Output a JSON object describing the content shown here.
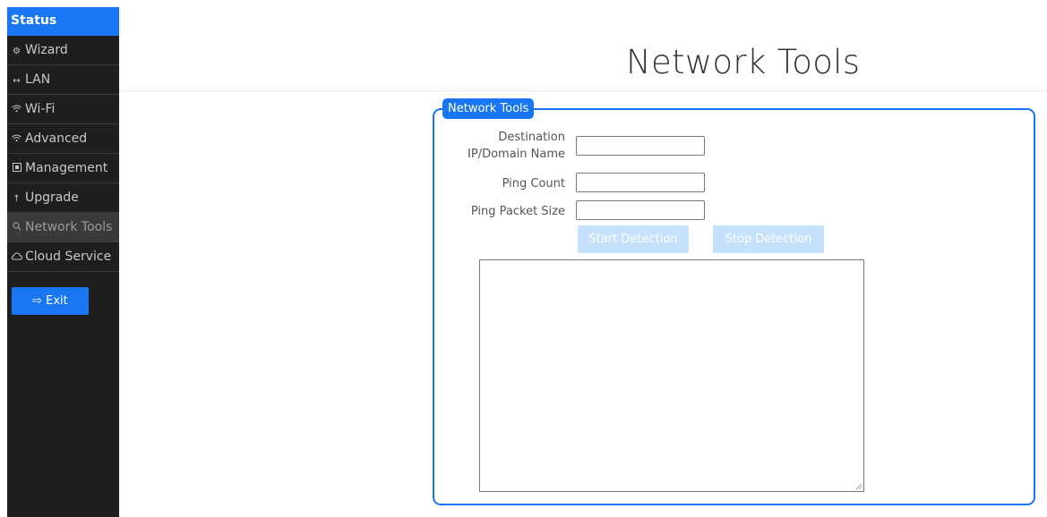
{
  "sidebar": {
    "items": [
      {
        "label": "Status",
        "icon": ""
      },
      {
        "label": "Wizard",
        "icon": "gear-icon"
      },
      {
        "label": "LAN",
        "icon": "arrows-icon"
      },
      {
        "label": "Wi-Fi",
        "icon": "wifi-icon"
      },
      {
        "label": "Advanced",
        "icon": "wifi-icon"
      },
      {
        "label": "Management",
        "icon": "management-icon"
      },
      {
        "label": "Upgrade",
        "icon": "upgrade-icon"
      },
      {
        "label": "Network Tools",
        "icon": "search-icon"
      },
      {
        "label": "Cloud Service",
        "icon": "cloud-icon"
      }
    ],
    "active": "Network Tools",
    "exit_label": "Exit"
  },
  "header": {
    "title": "Network Tools"
  },
  "form": {
    "legend": "Network Tools",
    "destination_label_line1": "Destination",
    "destination_label_line2": "IP/Domain Name",
    "destination_value": "",
    "ping_count_label": "Ping Count",
    "ping_count_value": "",
    "ping_packet_size_label": "Ping Packet Size",
    "ping_packet_size_value": "",
    "start_button": "Start Detection",
    "stop_button": "Stop Detection",
    "output_value": ""
  },
  "colors": {
    "accent": "#1976f2",
    "sidebar_bg": "#1e1e1e",
    "disabled_button": "#c6e1fb"
  }
}
